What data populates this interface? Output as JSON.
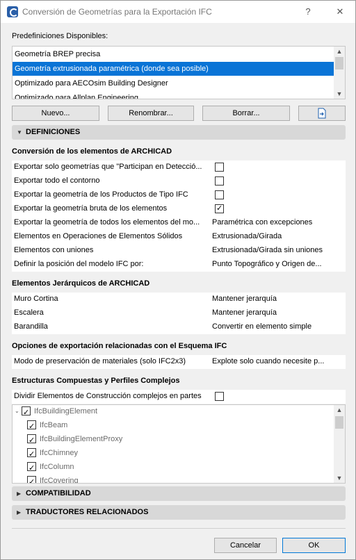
{
  "window": {
    "title": "Conversión de Geometrías para la Exportación IFC",
    "help_glyph": "?",
    "close_glyph": "✕"
  },
  "presets": {
    "label": "Predefiniciones Disponibles:",
    "items": [
      "Geometría BREP precisa",
      "Geometría extrusionada paramétrica (donde sea posible)",
      "Optimizado para AECOsim Building Designer",
      "Optimizado para Allplan Engineering"
    ],
    "selected_index": 1
  },
  "buttons": {
    "new": "Nuevo...",
    "rename": "Renombrar...",
    "delete": "Borrar...",
    "import_icon": "import-file-icon"
  },
  "sections": {
    "definitions": "DEFINICIONES",
    "compatibility": "COMPATIBILIDAD",
    "translators": "TRADUCTORES RELACIONADOS"
  },
  "groups": {
    "archicad_conversion": {
      "title": "Conversión de los elementos de ARCHICAD",
      "rows": [
        {
          "label": "Exportar solo geometrías que \"Participan en Detecció...",
          "checked": false
        },
        {
          "label": "Exportar todo el contorno",
          "checked": false
        },
        {
          "label": "Exportar la geometría de los Productos de Tipo IFC",
          "checked": false
        },
        {
          "label": "Exportar la geometría bruta de los elementos",
          "checked": true
        },
        {
          "label": "Exportar la geometría de todos los elementos del mo...",
          "value": "Paramétrica con excepciones"
        },
        {
          "label": "Elementos en Operaciones de Elementos Sólidos",
          "value": "Extrusionada/Girada"
        },
        {
          "label": "Elementos con uniones",
          "value": "Extrusionada/Girada sin uniones"
        },
        {
          "label": "Definir la posición del modelo IFC por:",
          "value": "Punto Topográfico y Origen de..."
        }
      ]
    },
    "hierarchical": {
      "title": "Elementos Jerárquicos de ARCHICAD",
      "rows": [
        {
          "label": "Muro Cortina",
          "value": "Mantener jerarquía"
        },
        {
          "label": "Escalera",
          "value": "Mantener jerarquía"
        },
        {
          "label": "Barandilla",
          "value": "Convertir en elemento simple"
        }
      ]
    },
    "schema_options": {
      "title": "Opciones de exportación relacionadas con el Esquema IFC",
      "rows": [
        {
          "label": "Modo de preservación de materiales (solo IFC2x3)",
          "value": "Explote solo cuando necesite p..."
        }
      ]
    },
    "composites": {
      "title": "Estructuras Compuestas y Perfiles Complejos",
      "split_label": "Dividir Elementos de Construcción complejos en partes",
      "split_checked": false
    }
  },
  "tree": {
    "root": {
      "label": "IfcBuildingElement",
      "checked": true
    },
    "children": [
      {
        "label": "IfcBeam",
        "checked": true
      },
      {
        "label": "IfcBuildingElementProxy",
        "checked": true
      },
      {
        "label": "IfcChimney",
        "checked": true
      },
      {
        "label": "IfcColumn",
        "checked": true
      },
      {
        "label": "IfcCovering",
        "checked": true
      }
    ]
  },
  "footer": {
    "cancel": "Cancelar",
    "ok": "OK"
  }
}
